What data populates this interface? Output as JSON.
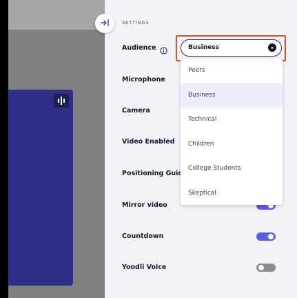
{
  "settings": {
    "heading": "SETTINGS",
    "audience": {
      "label": "Audience",
      "selected": "Business",
      "options": [
        "Peers",
        "Business",
        "Technical",
        "Children",
        "College Students",
        "Skeptical"
      ]
    },
    "rows": [
      {
        "label": "Microphone"
      },
      {
        "label": "Camera"
      },
      {
        "label": "Video Enabled"
      },
      {
        "label": "Positioning Guid"
      },
      {
        "label": "Mirror video",
        "toggle": "on"
      },
      {
        "label": "Countdown",
        "toggle": "on"
      },
      {
        "label": "Yoodli Voice",
        "toggle": "off"
      }
    ]
  },
  "colors": {
    "accent": "#5b5ee6",
    "focus_outline": "#e0501e",
    "panel_bg": "#f2f3f9",
    "video_bg": "#2f2f88"
  },
  "icons": [
    "collapse-panel-icon",
    "info-icon",
    "chevron-up-icon",
    "audio-level-icon"
  ]
}
